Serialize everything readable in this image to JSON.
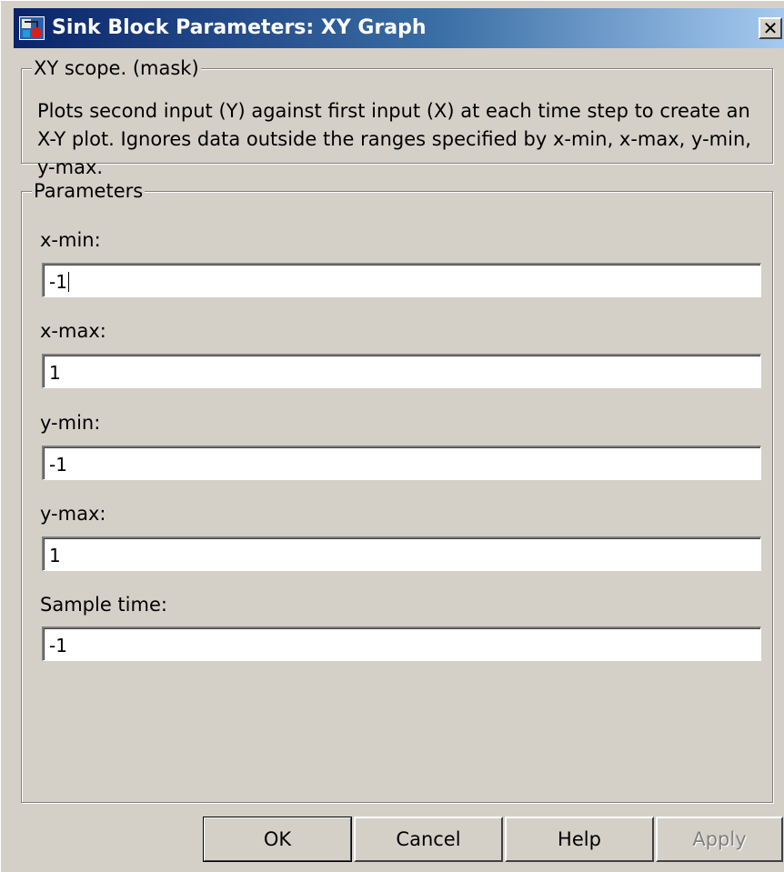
{
  "window": {
    "title": "Sink Block Parameters: XY Graph",
    "close_glyph": "✕",
    "icon": "simulink-block-icon"
  },
  "mask_group": {
    "legend": "XY scope. (mask)",
    "description": "Plots second input (Y) against first input (X) at each time step to  create an X-Y plot. Ignores data outside the ranges specified by x-min, x-max, y-min, y-max."
  },
  "parameters_group": {
    "legend": "Parameters",
    "fields": [
      {
        "label": "x-min:",
        "value": "-1"
      },
      {
        "label": "x-max:",
        "value": "1"
      },
      {
        "label": "y-min:",
        "value": "-1"
      },
      {
        "label": "y-max:",
        "value": "1"
      },
      {
        "label": "Sample time:",
        "value": "-1"
      }
    ]
  },
  "buttons": {
    "ok": "OK",
    "cancel": "Cancel",
    "help": "Help",
    "apply": "Apply"
  },
  "colors": {
    "titlebar_start": "#0a246a",
    "titlebar_end": "#a6caf0",
    "dialog_bg": "#d4d0c8",
    "disabled_text": "#808080"
  }
}
